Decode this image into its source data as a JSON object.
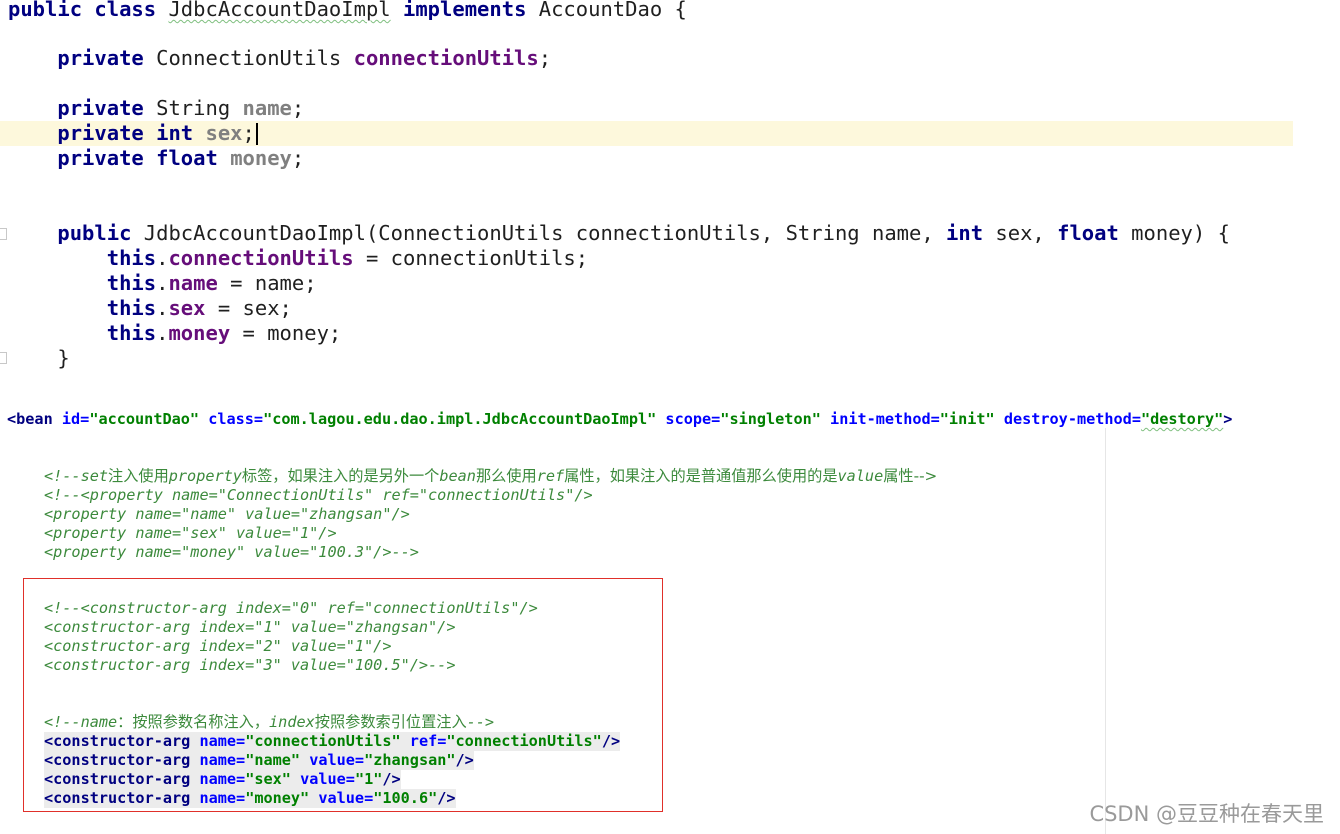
{
  "java": {
    "line1": {
      "kw1": "public",
      "kw2": "class",
      "cls": "JdbcAccountDaoImpl",
      "kw3": "implements",
      "iface": "AccountDao {"
    },
    "line2": {
      "kw": "private",
      "type": "ConnectionUtils",
      "field": "connectionUtils",
      "end": ";"
    },
    "line3": {
      "kw": "private",
      "type": "String",
      "field": "name",
      "end": ";"
    },
    "line4": {
      "kw": "private",
      "type": "int",
      "field": "sex",
      "end": ";"
    },
    "line5": {
      "kw": "private",
      "type": "float",
      "field": "money",
      "end": ";"
    },
    "ctor": {
      "kw": "public",
      "name": "JdbcAccountDaoImpl",
      "p1": "(ConnectionUtils connectionUtils, String name, ",
      "int": "int",
      "p2": " sex, ",
      "float": "float",
      "p3": " money) {"
    },
    "body": [
      {
        "kw": "this",
        "field": "connectionUtils",
        "rest": " = connectionUtils;"
      },
      {
        "kw": "this",
        "field": "name",
        "rest": " = name;"
      },
      {
        "kw": "this",
        "field": "sex",
        "rest": " = sex;"
      },
      {
        "kw": "this",
        "field": "money",
        "rest": " = money;"
      }
    ],
    "close": "}"
  },
  "xml": {
    "bean": {
      "open": "<bean",
      "id_attr": "id=",
      "id_val": "\"accountDao\"",
      "class_attr": "class=",
      "class_val": "\"com.lagou.edu.dao.impl.JdbcAccountDaoImpl\"",
      "scope_attr": "scope=",
      "scope_val": "\"singleton\"",
      "init_attr": "init-method=",
      "init_val": "\"init\"",
      "destroy_attr": "destroy-method=",
      "destroy_val": "\"destory\"",
      "end": ">"
    },
    "comment1": {
      "a": "<!--set",
      "b": "注入使用",
      "c": "property",
      "d": "标签，如果注入的是另外一个",
      "e": "bean",
      "f": "那么使用",
      "g": "ref",
      "h": "属性，如果注入的是普通值那么使用的是",
      "i": "value",
      "j": "属性-->"
    },
    "comment_props": [
      "<!--<property name=\"ConnectionUtils\" ref=\"connectionUtils\"/>",
      "<property name=\"name\" value=\"zhangsan\"/>",
      "<property name=\"sex\" value=\"1\"/>",
      "<property name=\"money\" value=\"100.3\"/>-->"
    ],
    "comment_ctor": [
      "<!--<constructor-arg index=\"0\" ref=\"connectionUtils\"/>",
      "<constructor-arg index=\"1\" value=\"zhangsan\"/>",
      "<constructor-arg index=\"2\" value=\"1\"/>",
      "<constructor-arg index=\"3\" value=\"100.5\"/>-->"
    ],
    "comment2": {
      "a": "<!--name",
      "b": "：按照参数名称注入，",
      "c": "index",
      "d": "按照参数索引位置注入",
      "e": "-->"
    },
    "ctor_args": [
      {
        "tag": "<constructor-arg",
        "a1": "name=",
        "v1": "\"connectionUtils\"",
        "a2": "ref=",
        "v2": "\"connectionUtils\"",
        "end": "/>"
      },
      {
        "tag": "<constructor-arg",
        "a1": "name=",
        "v1": "\"name\"",
        "a2": "value=",
        "v2": "\"zhangsan\"",
        "end": "/>"
      },
      {
        "tag": "<constructor-arg",
        "a1": "name=",
        "v1": "\"sex\"",
        "a2": "value=",
        "v2": "\"1\"",
        "end": "/>"
      },
      {
        "tag": "<constructor-arg",
        "a1": "name=",
        "v1": "\"money\"",
        "a2": "value=",
        "v2": "\"100.6\"",
        "end": "/>"
      }
    ]
  },
  "watermark": "CSDN @豆豆种在春天里",
  "colors": {
    "keyword": "#000080",
    "field": "#660e7a",
    "xml_attr": "#0000ff",
    "xml_value": "#008000",
    "comment": "#3c8a3c",
    "highlight_box": "#e0302a"
  }
}
